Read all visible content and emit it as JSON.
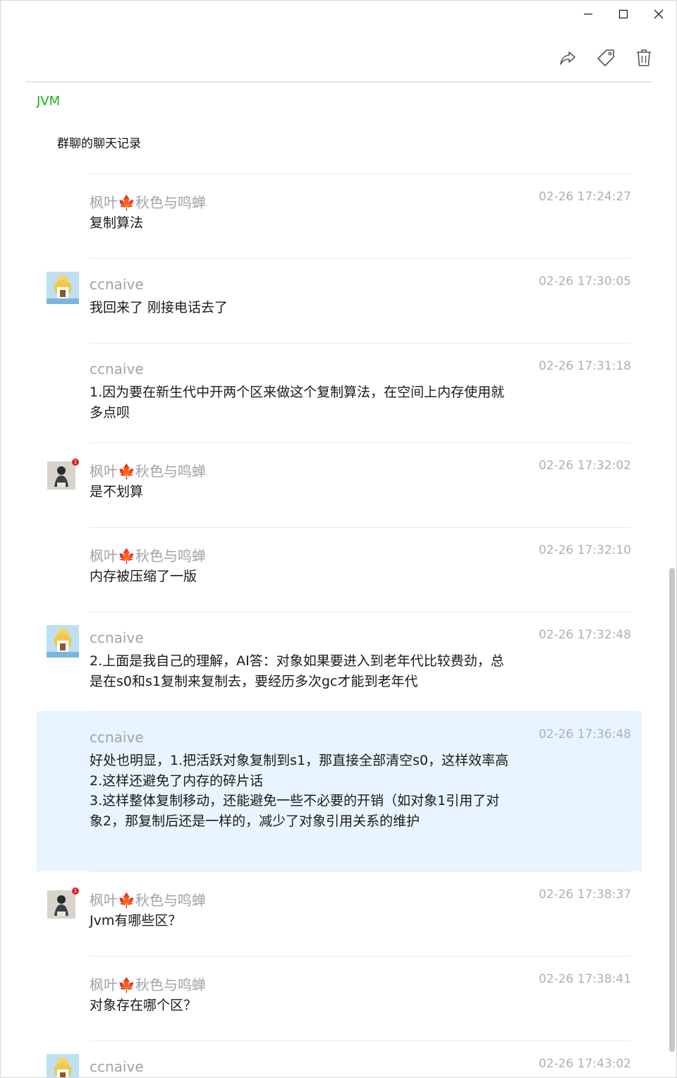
{
  "window": {
    "minimize_icon": "minimize-icon",
    "maximize_icon": "maximize-icon",
    "close_icon": "close-icon"
  },
  "toolbar": {
    "forward_icon": "forward-icon",
    "tag_icon": "tag-icon",
    "delete_icon": "trash-icon"
  },
  "tag": "JVM",
  "heading": "群聊的聊天记录",
  "colors": {
    "tag_green": "#14b814",
    "highlight_bg": "#e8f4ff",
    "name_gray": "#a3a3a3",
    "badge_red": "#e02020"
  },
  "messages": [
    {
      "name": "枫叶🍁秋色与鸣蝉",
      "time": "02-26 17:24:27",
      "text": "复制算法",
      "avatar": "none",
      "highlight": false
    },
    {
      "name": "ccnaive",
      "time": "02-26 17:30:05",
      "text": "我回来了 刚接电话去了",
      "avatar": "anime-avatar",
      "highlight": false
    },
    {
      "name": "ccnaive",
      "time": "02-26 17:31:18",
      "text": "1.因为要在新生代中开两个区来做这个复制算法，在空间上内存使用就多点呗",
      "avatar": "none",
      "highlight": false
    },
    {
      "name": "枫叶🍁秋色与鸣蝉",
      "time": "02-26 17:32:02",
      "text": "是不划算",
      "avatar": "person-avatar",
      "badge": "1",
      "highlight": false
    },
    {
      "name": "枫叶🍁秋色与鸣蝉",
      "time": "02-26 17:32:10",
      "text": "内存被压缩了一版",
      "avatar": "none",
      "highlight": false
    },
    {
      "name": "ccnaive",
      "time": "02-26 17:32:48",
      "text": "2.上面是我自己的理解，AI答：对象如果要进入到老年代比较费劲，总是在s0和s1复制来复制去，要经历多次gc才能到老年代",
      "avatar": "anime-avatar",
      "highlight": false
    },
    {
      "name": "ccnaive",
      "time": "02-26 17:36:48",
      "text": "好处也明显，1.把活跃对象复制到s1，那直接全部清空s0，这样效率高\n2.这样还避免了内存的碎片话\n3.这样整体复制移动，还能避免一些不必要的开销（如对象1引用了对象2，那复制后还是一样的，减少了对象引用关系的维护",
      "avatar": "none",
      "highlight": true
    },
    {
      "name": "枫叶🍁秋色与鸣蝉",
      "time": "02-26 17:38:37",
      "text": "Jvm有哪些区？",
      "avatar": "person-avatar",
      "badge": "1",
      "highlight": false
    },
    {
      "name": "枫叶🍁秋色与鸣蝉",
      "time": "02-26 17:38:41",
      "text": "对象存在哪个区？",
      "avatar": "none",
      "highlight": false
    },
    {
      "name": "ccnaive",
      "time": "02-26 17:43:02",
      "text": "",
      "avatar": "anime-avatar",
      "highlight": false
    }
  ]
}
